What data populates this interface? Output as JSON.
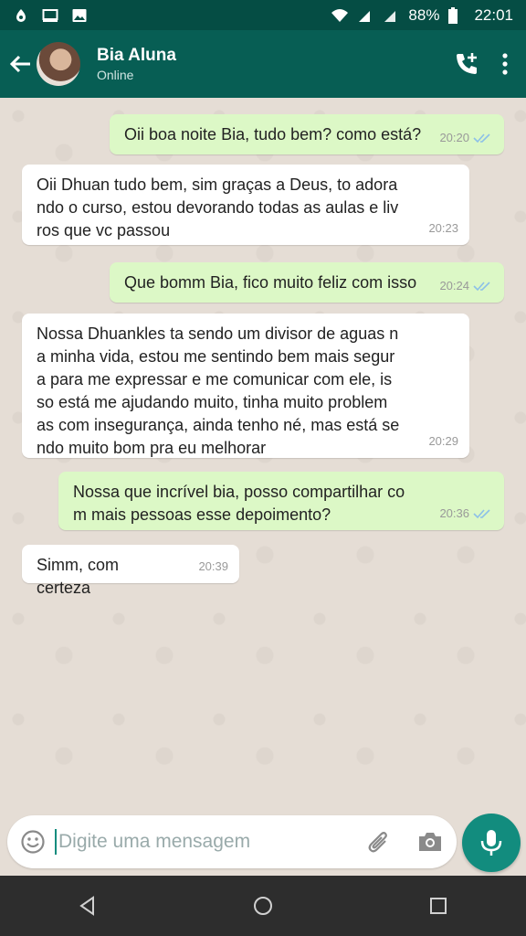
{
  "status_bar": {
    "battery": "88%",
    "time": "22:01"
  },
  "header": {
    "contact_name": "Bia Aluna",
    "contact_status": "Online"
  },
  "messages": [
    {
      "direction": "out",
      "text": "Oii boa noite Bia, tudo bem? como está?",
      "time": "20:20",
      "read": true
    },
    {
      "direction": "in",
      "text": "Oii Dhuan tudo bem, sim graças a Deus, to adora\nndo o curso, estou devorando todas as aulas e liv\nros que vc passou",
      "time": "20:23"
    },
    {
      "direction": "out",
      "text": "Que bomm Bia, fico muito feliz com isso",
      "time": "20:24",
      "read": true
    },
    {
      "direction": "in",
      "text": "Nossa Dhuankles ta sendo um divisor de aguas n\na minha vida, estou me sentindo bem mais segur\na para me expressar e me comunicar com ele, is\nso está me ajudando muito, tinha muito problem\nas com insegurança, ainda tenho né, mas está se\nndo muito bom pra eu melhorar",
      "time": "20:29"
    },
    {
      "direction": "out",
      "text": "Nossa que incrível bia, posso compartilhar co\nm mais pessoas esse depoimento?",
      "time": "20:36",
      "read": true
    },
    {
      "direction": "in",
      "text": "Simm, com certeza",
      "time": "20:39"
    }
  ],
  "composer": {
    "placeholder": "Digite uma mensagem"
  },
  "colors": {
    "header": "#075e54",
    "status_bar": "#054d44",
    "outgoing_bubble": "#dcf8c6",
    "incoming_bubble": "#ffffff",
    "accent": "#128c7e",
    "read_ticks": "#4fc3f7"
  },
  "icons": {
    "back": "arrow-left-icon",
    "add_call": "phone-plus-icon",
    "menu": "more-vertical-icon",
    "emoji": "emoji-icon",
    "attach": "paperclip-icon",
    "camera": "camera-icon",
    "mic": "microphone-icon"
  }
}
